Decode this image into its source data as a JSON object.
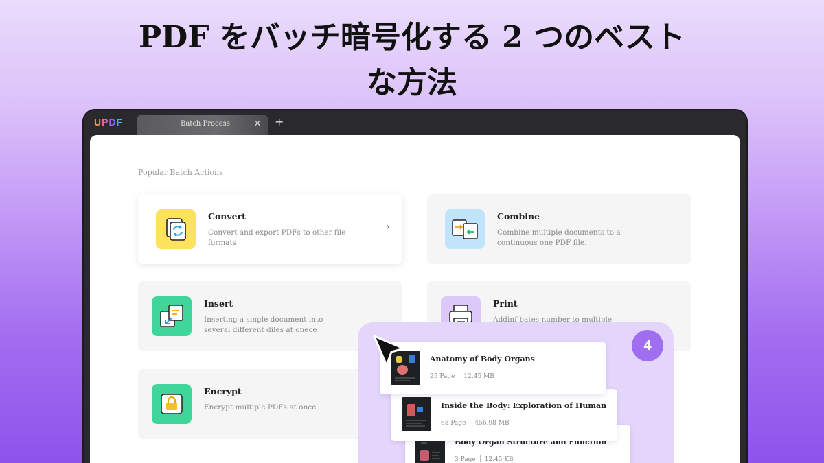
{
  "headline": {
    "line1": "PDF をバッチ暗号化する 2 つのベスト",
    "line2": "な方法"
  },
  "app": {
    "logo": "UPDF",
    "tab_label": "Batch Process",
    "tab_close": "×",
    "tab_add": "+"
  },
  "main": {
    "section_title": "Popular Batch Actions",
    "actions": [
      {
        "title": "Convert",
        "desc": "Convert and export PDFs to other file formats",
        "icon": "convert-icon",
        "color": "#fde25e",
        "arrow": "›"
      },
      {
        "title": "Combine",
        "desc": "Combine multiple documents to a continuous one PDF file.",
        "icon": "combine-icon",
        "color": "#bfe4fb"
      },
      {
        "title": "Insert",
        "desc": "Inserting a single document into several different diles at onece",
        "icon": "insert-icon",
        "color": "#3fd69a"
      },
      {
        "title": "Print",
        "desc": "Addinf bates number to multiple documents",
        "icon": "print-icon",
        "color": "#dcc9f9"
      },
      {
        "title": "Encrypt",
        "desc": "Encrypt multiple PDFs at once",
        "icon": "encrypt-icon",
        "color": "#3fd69a"
      }
    ]
  },
  "overlay": {
    "count": "4",
    "files": [
      {
        "name": "Anatomy of Body Organs",
        "pages": "25 Page",
        "size": "12.45 MB"
      },
      {
        "name": "Inside the Body: Exploration of Human",
        "pages": "68 Page",
        "size": "456.98 MB"
      },
      {
        "name": "Body Organ Structure and Function",
        "pages": "3 Page",
        "size": "12.45 KB"
      }
    ]
  },
  "colors": {
    "accent": "#a06ef0",
    "overlay_bg": "#e4d6fb",
    "frame": "#2a2a2c"
  }
}
